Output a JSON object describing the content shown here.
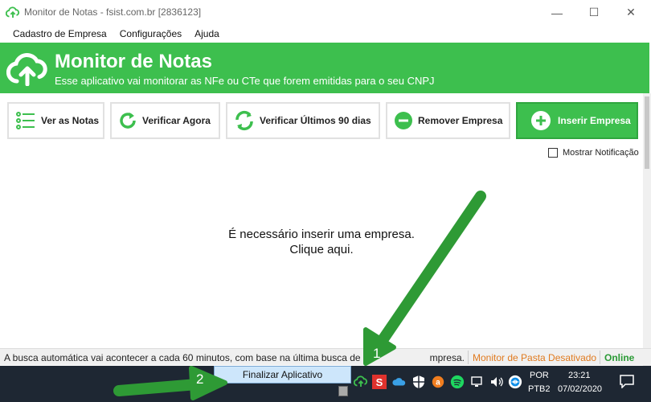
{
  "window": {
    "title": "Monitor de Notas - fsist.com.br [2836123]"
  },
  "menu": [
    "Cadastro de Empresa",
    "Configurações",
    "Ajuda"
  ],
  "banner": {
    "title": "Monitor de Notas",
    "subtitle": "Esse aplicativo vai monitorar as NFe ou CTe que forem emitidas para o seu CNPJ",
    "color": "#3dbf4e"
  },
  "toolbar": {
    "ver_notas": "Ver as Notas",
    "verificar_agora": "Verificar Agora",
    "verificar_90": "Verificar Últimos 90 dias",
    "remover_empresa": "Remover Empresa",
    "inserir_empresa": "Inserir Empresa"
  },
  "mostrar_notificacao": "Mostrar Notificação",
  "main": {
    "line1": "É necessário inserir uma empresa.",
    "line2": "Clique aqui."
  },
  "status": {
    "message": "A busca automática vai acontecer a cada 60 minutos, com base na última busca de ca",
    "message_tail": "mpresa.",
    "pasta": "Monitor de Pasta Desativado",
    "online": "Online"
  },
  "taskbar": {
    "popup": "Finalizar Aplicativo",
    "lang1": "POR",
    "lang2": "PTB2",
    "time": "23:21",
    "date": "07/02/2020"
  },
  "annotations": {
    "one": "1",
    "two": "2"
  },
  "icons": [
    "app-cloud-icon",
    "minimize-icon",
    "maximize-icon",
    "close-icon",
    "list-icon",
    "refresh-icon",
    "refresh-double-icon",
    "minus-circle-icon",
    "plus-circle-icon",
    "notification-icon"
  ]
}
